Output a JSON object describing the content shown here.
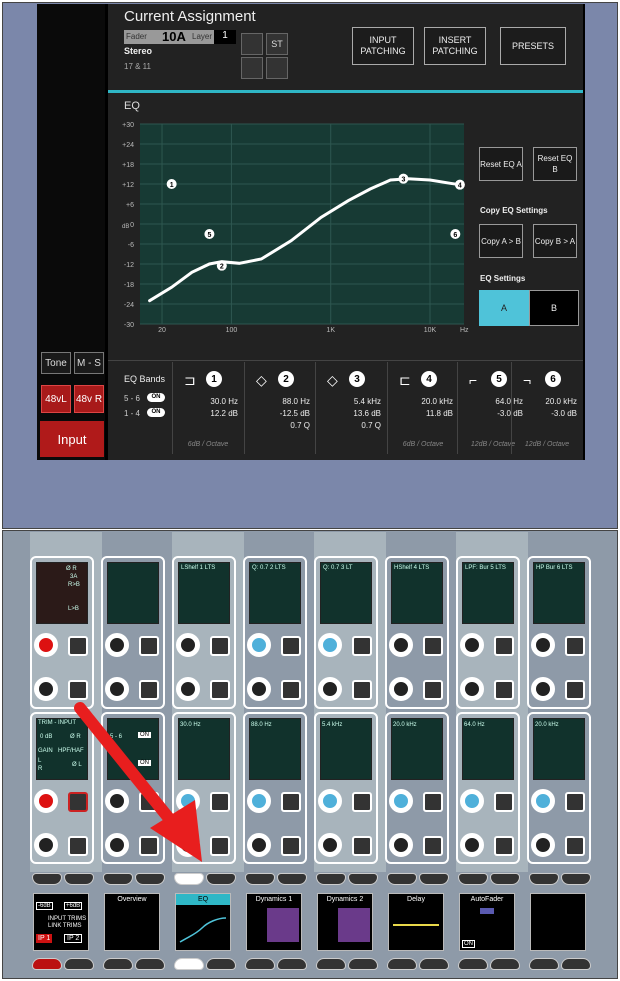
{
  "assignment": {
    "title": "Current Assignment",
    "fader_label": "Fader",
    "fader_value": "10A",
    "layer_label": "Layer",
    "layer_value": "1",
    "type": "Stereo",
    "range": "17 & 11",
    "st_label": "ST"
  },
  "top_buttons": {
    "input_patching": "INPUT PATCHING",
    "insert_patching": "INSERT PATCHING",
    "presets": "PRESETS"
  },
  "left_panel": {
    "tone": "Tone",
    "ms": "M - S",
    "p48_left": "48vL",
    "p48_right": "48v R",
    "input": "Input"
  },
  "eq": {
    "title": "EQ",
    "y_ticks": [
      "+30",
      "+24",
      "+18",
      "+12",
      "+6",
      "0",
      "-6",
      "-12",
      "-18",
      "-24",
      "-30"
    ],
    "y_unit": "dB",
    "x_ticks": [
      "20",
      "100",
      "1K",
      "10K"
    ],
    "x_unit": "Hz",
    "nodes": [
      {
        "id": "1",
        "freq": 25,
        "gain": 12
      },
      {
        "id": "2",
        "freq": 80,
        "gain": -12.5
      },
      {
        "id": "3",
        "freq": 5400,
        "gain": 13.6
      },
      {
        "id": "4",
        "freq": 20000,
        "gain": 11.8
      },
      {
        "id": "5",
        "freq": 60,
        "gain": -3
      },
      {
        "id": "6",
        "freq": 18000,
        "gain": -3
      }
    ],
    "curve": [
      [
        15,
        -23
      ],
      [
        25,
        -19
      ],
      [
        40,
        -14.5
      ],
      [
        60,
        -12
      ],
      [
        80,
        -11.3
      ],
      [
        120,
        -11.8
      ],
      [
        200,
        -10.5
      ],
      [
        400,
        -5
      ],
      [
        800,
        2
      ],
      [
        1500,
        7
      ],
      [
        2500,
        10.5
      ],
      [
        4000,
        13.2
      ],
      [
        6000,
        13.6
      ],
      [
        10000,
        13.2
      ],
      [
        16000,
        12.2
      ],
      [
        20000,
        11.8
      ]
    ],
    "reset_a": "Reset EQ A",
    "reset_b": "Reset EQ B",
    "copy_title": "Copy EQ Settings",
    "copy_ab": "Copy A > B",
    "copy_ba": "Copy B > A",
    "settings_title": "EQ Settings",
    "setting_a": "A",
    "setting_b": "B",
    "active_color": "#4fc3d9"
  },
  "bands_label": "EQ Bands",
  "band_toggles": [
    {
      "label": "5 - 6",
      "state": "ON"
    },
    {
      "label": "1 - 4",
      "state": "ON"
    }
  ],
  "bands": [
    {
      "num": "1",
      "icon": "low-shelf",
      "freq": "30.0 Hz",
      "gain": "12.2 dB",
      "q": "",
      "slope": "6dB / Octave"
    },
    {
      "num": "2",
      "icon": "bell",
      "freq": "88.0 Hz",
      "gain": "-12.5 dB",
      "q": "0.7 Q",
      "slope": ""
    },
    {
      "num": "3",
      "icon": "bell",
      "freq": "5.4 kHz",
      "gain": "13.6 dB",
      "q": "0.7 Q",
      "slope": ""
    },
    {
      "num": "4",
      "icon": "high-shelf",
      "freq": "20.0 kHz",
      "gain": "11.8 dB",
      "q": "",
      "slope": "6dB / Octave"
    },
    {
      "num": "5",
      "icon": "hpf",
      "freq": "64.0 Hz",
      "gain": "-3.0 dB",
      "q": "",
      "slope": "12dB / Octave"
    },
    {
      "num": "6",
      "icon": "lpf",
      "freq": "20.0 kHz",
      "gain": "-3.0 dB",
      "q": "",
      "slope": "12dB / Octave"
    }
  ],
  "console": {
    "strip1": {
      "lines": [
        "Ø R",
        "3A",
        "R>B",
        "L>B"
      ]
    },
    "strip_top_titles": [
      "",
      "",
      "LShelf 1 LTS",
      "Q: 0.7 2 LTS",
      "Q: 0.7 3 LT",
      "HShelf 4 LTS",
      "LPF: Bur 5 LTS",
      "HP Bur 6 LTS"
    ],
    "trim": {
      "title": "TRIM - INPUT",
      "gain": "0 dB",
      "phase": "Ø R",
      "gain_lbl": "GAIN",
      "hpf_lbl": "HPF/HAF",
      "l": "L",
      "r": "R",
      "phase2": "Ø L"
    },
    "band_toggle_lbl_56": "5 - 6",
    "band_toggle_lbl_14": "4",
    "on": "ON",
    "mid_vals": [
      "30.0 Hz",
      "88.0 Hz",
      "5.4 kHz",
      "20.0 kHz",
      "64.0 Hz",
      "20.0 kHz"
    ],
    "bottom": {
      "input_trims": "INPUT TRIMS",
      "link_trims": "LINK TRIMS",
      "minus6": "-6dB",
      "plus6": "+6dB",
      "ip1": "IP 1",
      "ip2": "IP 2",
      "overview": "Overview",
      "eq": "EQ",
      "dyn1": "Dynamics 1",
      "dyn2": "Dynamics 2",
      "delay": "Delay",
      "autofader": "AutoFader",
      "on_small": "ON"
    }
  }
}
